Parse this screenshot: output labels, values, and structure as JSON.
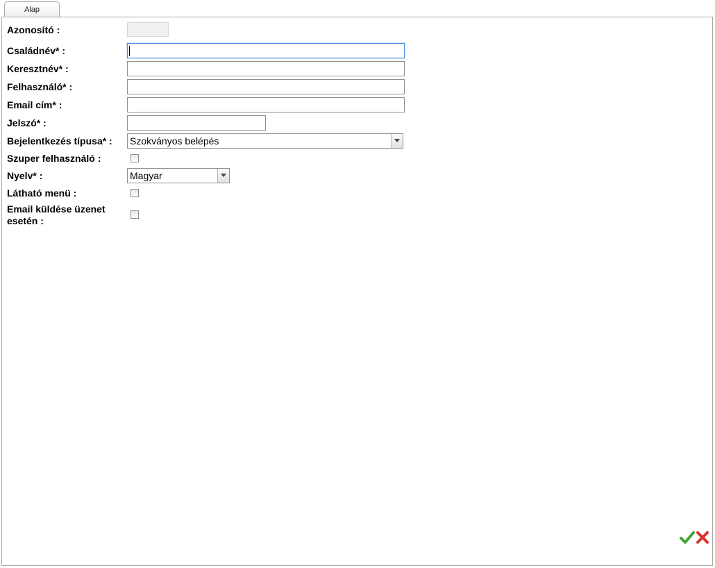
{
  "tabs": [
    {
      "label": "Alap"
    }
  ],
  "form": {
    "azonosito": {
      "label": "Azonosító :",
      "value": ""
    },
    "csaladnev": {
      "label": "Családnév* :",
      "value": ""
    },
    "keresztnev": {
      "label": "Keresztnév* :",
      "value": ""
    },
    "felhasznalo": {
      "label": "Felhasználó* :",
      "value": ""
    },
    "email": {
      "label": "Email cím* :",
      "value": ""
    },
    "jelszo": {
      "label": "Jelszó* :",
      "value": ""
    },
    "bejelentkezes": {
      "label": "Bejelentkezés típusa* :",
      "value": "Szokványos belépés"
    },
    "szuper": {
      "label": "Szuper felhasználó :",
      "checked": false
    },
    "nyelv": {
      "label": "Nyelv* :",
      "value": "Magyar"
    },
    "lathato_menu": {
      "label": "Látható menü :",
      "checked": false
    },
    "email_kuldes": {
      "label": "Email küldése üzenet esetén :",
      "checked": false
    }
  },
  "actions": {
    "confirm_icon": "check-icon",
    "cancel_icon": "cross-icon",
    "confirm_color": "#3fa535",
    "cancel_color": "#d8342c"
  }
}
